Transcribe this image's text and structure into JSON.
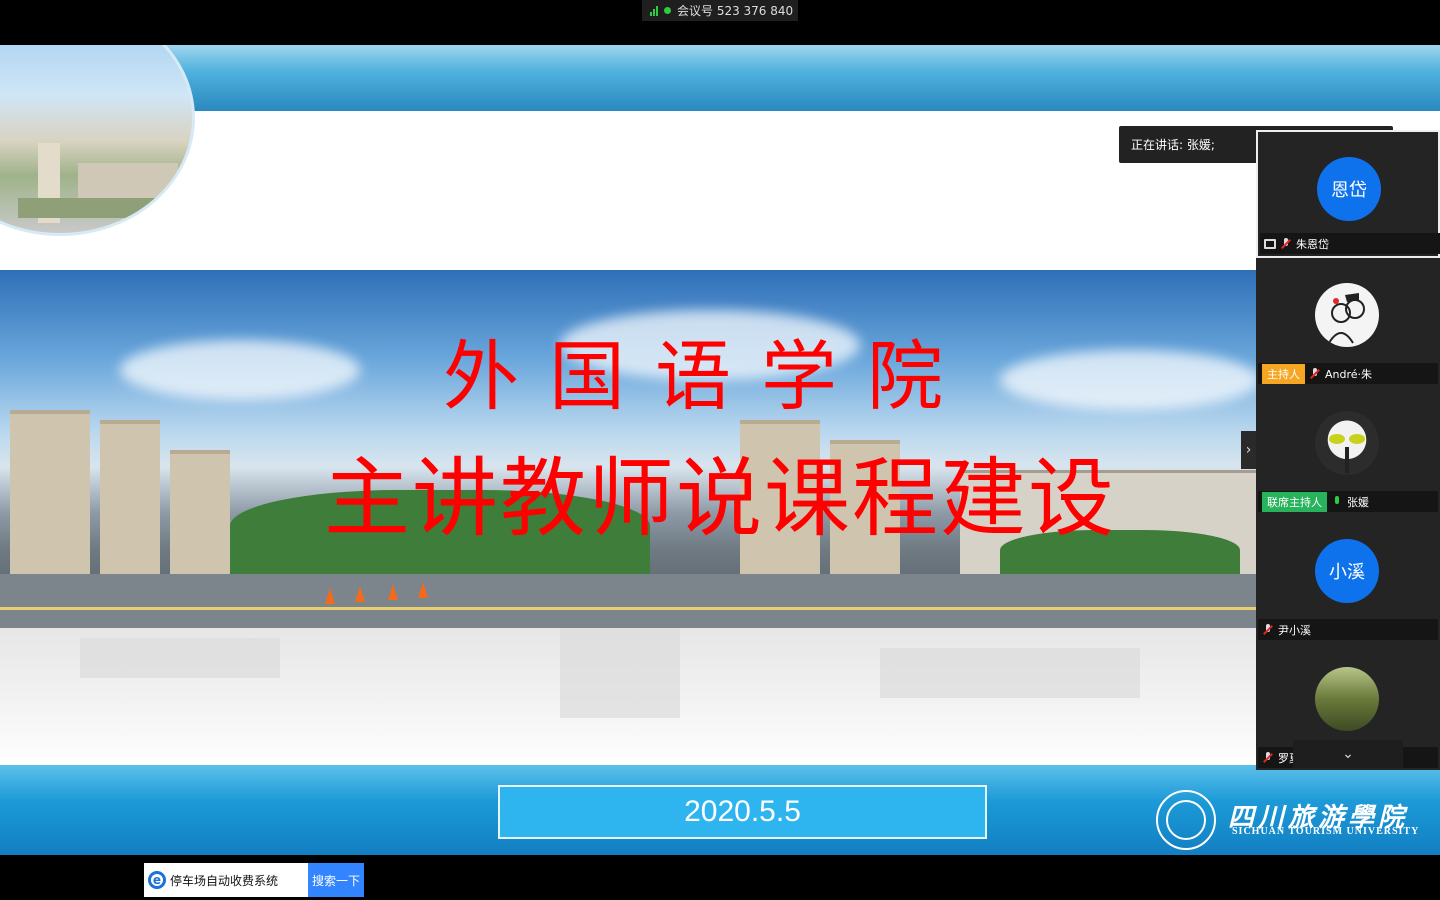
{
  "meeting": {
    "label": "会议号 523 376 840"
  },
  "slide": {
    "title_line1": "外国语学院",
    "title_line2": "主讲教师说课程建设",
    "date": "2020.5.5",
    "school_name_cn": "四川旅游學院",
    "school_name_en": "SICHUAN TOURISM UNIVERSITY",
    "title_color": "#ff0000",
    "accent_blue": "#2eb5f0"
  },
  "speaking": {
    "label": "正在讲话: 张媛;"
  },
  "participants": [
    {
      "avatar_text": "恩岱",
      "name": "朱恩岱",
      "tag": "",
      "mic": "muted",
      "avatar_type": "initials",
      "sharing": true
    },
    {
      "avatar_text": "",
      "name": "André·朱",
      "tag": "主持人",
      "mic": "muted",
      "avatar_type": "sketch"
    },
    {
      "avatar_text": "",
      "name": "张媛",
      "tag": "联席主持人",
      "mic": "live",
      "avatar_type": "mask"
    },
    {
      "avatar_text": "小溪",
      "name": "尹小溪",
      "tag": "",
      "mic": "muted",
      "avatar_type": "initials"
    },
    {
      "avatar_text": "",
      "name": "罗夏梓平",
      "tag": "",
      "mic": "muted",
      "avatar_type": "photo"
    }
  ],
  "ad": {
    "text": "停车场自动收费系统",
    "button": "搜索一下"
  },
  "icons": {
    "panel_next": "chevron-right-icon",
    "panel_collapse": "chevron-down-icon"
  }
}
